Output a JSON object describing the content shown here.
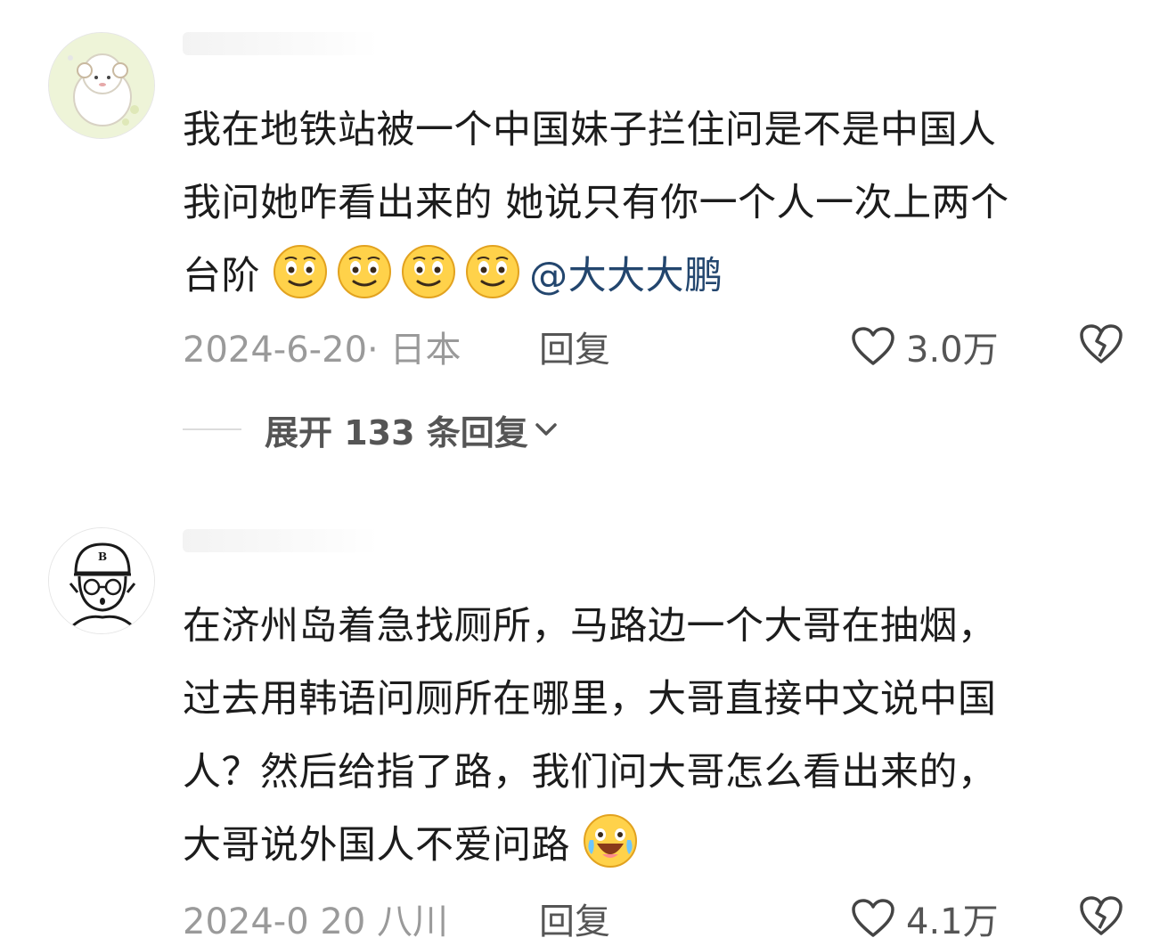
{
  "comments": [
    {
      "username": "",
      "text_lines": [
        "我在地铁站被一个中国妹子拦住问是不是中国人",
        "我问她咋看出来的 她说只有你一个人一次上两个",
        "台阶"
      ],
      "mention": "@大大大鹏",
      "date": "2024-6-20· 日本",
      "reply_label": "回复",
      "likes": "3.0万",
      "expand_label": "展开 133 条回复"
    },
    {
      "username": "",
      "text_lines": [
        "在济州岛着急找厕所，马路边一个大哥在抽烟，",
        "过去用韩语问厕所在哪里，大哥直接中文说中国",
        "人？然后给指了路，我们问大哥怎么看出来的，",
        "大哥说外国人不爱问路"
      ],
      "date": "2024-0 20 八川",
      "reply_label": "回复",
      "likes": "4.1万"
    }
  ],
  "icons": {
    "like": "heart-outline-icon",
    "dislike": "broken-heart-icon",
    "expand": "chevron-down-icon",
    "emoji_smile": "smile-emoji",
    "emoji_laugh_cry": "laugh-cry-emoji"
  },
  "colors": {
    "text": "#1c1c1c",
    "meta": "#9a9a9a",
    "mention": "#23466e",
    "emoji_fill": "#ffd24a"
  }
}
